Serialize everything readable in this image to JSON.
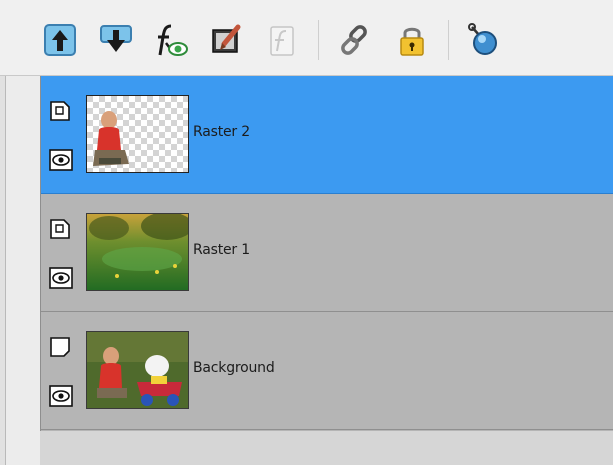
{
  "toolbar": {
    "buttons": [
      {
        "name": "move-layer-up-button",
        "icon": "arrow-up-icon"
      },
      {
        "name": "move-layer-down-button",
        "icon": "arrow-down-icon"
      },
      {
        "name": "layer-effects-button",
        "icon": "fx-eye-icon"
      },
      {
        "name": "layer-properties-button",
        "icon": "paint-brush-icon"
      },
      {
        "name": "layer-style-button",
        "icon": "style-icon-disabled"
      },
      {
        "name": "link-layers-button",
        "icon": "chain-link-icon"
      },
      {
        "name": "lock-layer-button",
        "icon": "padlock-icon"
      },
      {
        "name": "layer-opacity-button",
        "icon": "blue-knob-icon"
      }
    ],
    "colors": {
      "accent": "#3c9af1",
      "selected_row": "#3c9af1",
      "row_bg": "#b5b5b5"
    }
  },
  "layers": [
    {
      "label": "Raster 2",
      "selected": true,
      "visible": true,
      "thumbnail": "child-on-transparent"
    },
    {
      "label": "Raster 1",
      "selected": false,
      "visible": true,
      "thumbnail": "green-meadow"
    },
    {
      "label": "Background",
      "selected": false,
      "visible": true,
      "thumbnail": "child-with-toy-car"
    }
  ]
}
